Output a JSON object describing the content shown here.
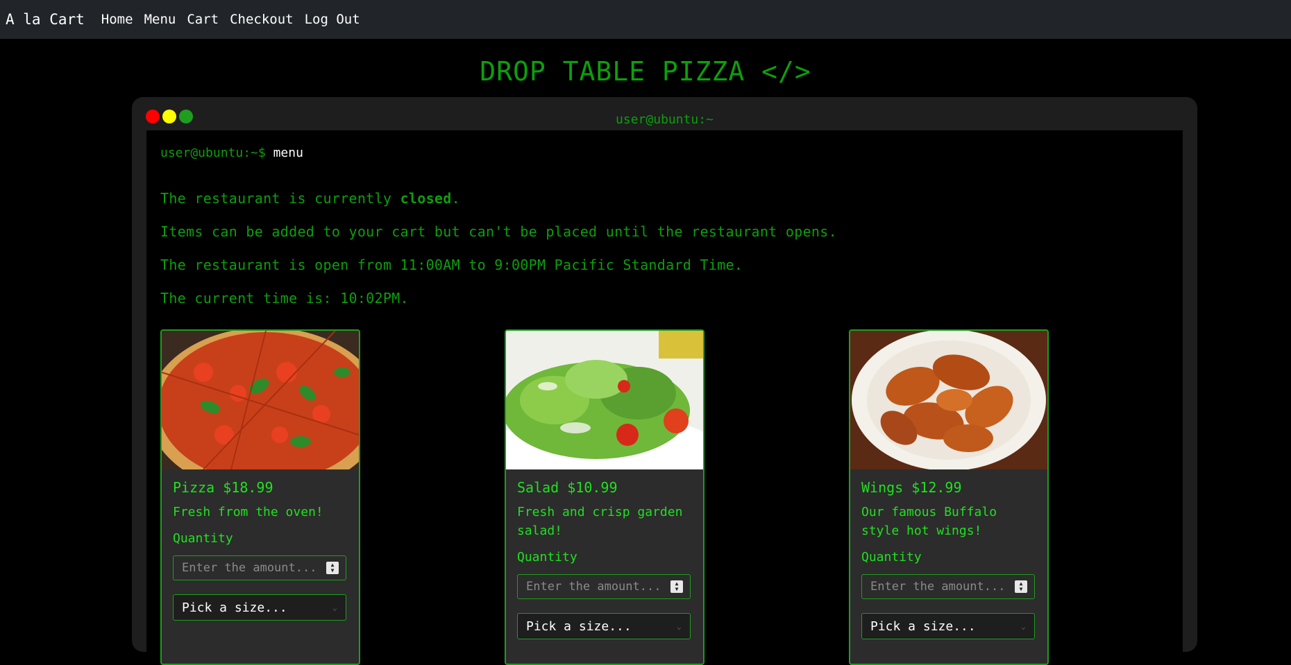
{
  "nav": {
    "brand": "A la Cart",
    "links": [
      "Home",
      "Menu",
      "Cart",
      "Checkout",
      "Log Out"
    ]
  },
  "page_title": "DROP TABLE PIZZA </>",
  "terminal": {
    "title": "user@ubuntu:~",
    "prompt_user": "user@ubuntu:~$",
    "prompt_cmd": "menu"
  },
  "status": {
    "closed_prefix": "The restaurant is currently ",
    "closed_word": "closed",
    "closed_suffix": ".",
    "note": "Items can be added to your cart but can't be placed until the restaurant opens.",
    "hours": "The restaurant is open from 11:00AM to 9:00PM Pacific Standard Time.",
    "current_time": "The current time is: 10:02PM."
  },
  "items": [
    {
      "title": "Pizza $18.99",
      "desc": "Fresh from the oven!",
      "qty_label": "Quantity",
      "qty_placeholder": "Enter the amount...",
      "size_placeholder": "Pick a size..."
    },
    {
      "title": "Salad $10.99",
      "desc": "Fresh and crisp garden salad!",
      "qty_label": "Quantity",
      "qty_placeholder": "Enter the amount...",
      "size_placeholder": "Pick a size..."
    },
    {
      "title": "Wings $12.99",
      "desc": "Our famous Buffalo style hot wings!",
      "qty_label": "Quantity",
      "qty_placeholder": "Enter the amount...",
      "size_placeholder": "Pick a size..."
    }
  ],
  "colors": {
    "terminal_green": "#0c9f0c",
    "bright_green": "#20e020",
    "navbar_bg": "#212529"
  }
}
